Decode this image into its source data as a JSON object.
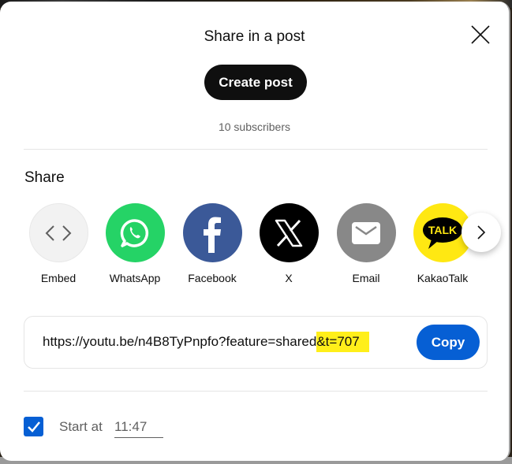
{
  "dialog": {
    "title": "Share in a post",
    "close_icon": "close-icon",
    "create_post_label": "Create post",
    "subscribers": "10 subscribers"
  },
  "share": {
    "heading": "Share",
    "items": [
      {
        "label": "Embed",
        "icon": "embed-icon",
        "color": "#f2f2f2"
      },
      {
        "label": "WhatsApp",
        "icon": "whatsapp-icon",
        "color": "#25d366"
      },
      {
        "label": "Facebook",
        "icon": "facebook-icon",
        "color": "#3b5998"
      },
      {
        "label": "X",
        "icon": "x-icon",
        "color": "#000000"
      },
      {
        "label": "Email",
        "icon": "email-icon",
        "color": "#888888"
      },
      {
        "label": "KakaoTalk",
        "icon": "kakaotalk-icon",
        "color": "#ffe812"
      }
    ],
    "next_icon": "chevron-right-icon"
  },
  "link": {
    "url_main": "https://youtu.be/n4B8TyPnpfo?feature=shared",
    "url_highlighted": "&t=707",
    "highlight_color": "#ffef1a",
    "copy_label": "Copy"
  },
  "start_at": {
    "checked": true,
    "label": "Start at",
    "value": "11:47"
  },
  "colors": {
    "accent": "#065fd4",
    "primary_button": "#0f0f0f"
  }
}
